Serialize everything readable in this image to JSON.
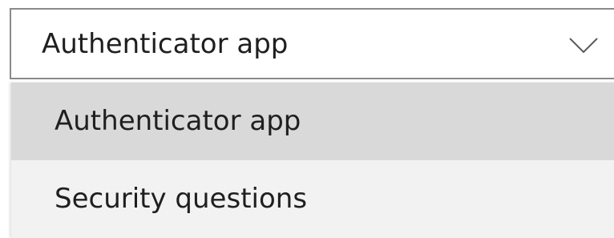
{
  "select": {
    "value": "Authenticator app",
    "icon": "chevron-down-icon"
  },
  "dropdown": {
    "options": [
      {
        "label": "Authenticator app",
        "state": "hovered"
      },
      {
        "label": "Security questions",
        "state": "normal"
      }
    ]
  },
  "colors": {
    "border": "#8a8a8a",
    "hover_background": "#d9d9d9",
    "list_background": "#f2f2f2",
    "text": "#1f1f1f"
  }
}
